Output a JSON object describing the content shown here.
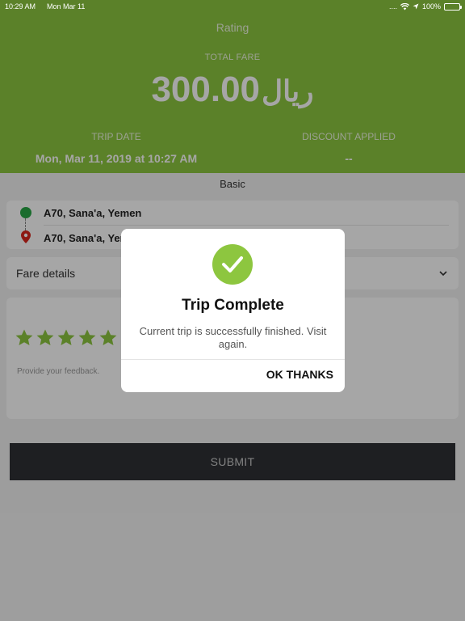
{
  "status_bar": {
    "time": "10:29 AM",
    "date": "Mon Mar 11",
    "battery": "100%"
  },
  "header": {
    "title": "Rating",
    "total_fare_label": "TOTAL FARE",
    "amount": "300.00",
    "currency": "ريال",
    "trip_date_label": "TRIP DATE",
    "trip_date_value": "Mon, Mar 11, 2019 at 10:27 AM",
    "discount_label": "DISCOUNT APPLIED",
    "discount_value": "--"
  },
  "vehicle_type": "Basic",
  "route": {
    "pickup": "A70,  Sana'a,  Yemen",
    "dropoff": "A70,  Sana'a,  Yemen"
  },
  "fare_details_label": "Fare details",
  "rating": {
    "stars": 5,
    "feedback_placeholder": "Provide your feedback."
  },
  "submit_label": "SUBMIT",
  "dialog": {
    "title": "Trip Complete",
    "message": "Current trip is successfully finished. Visit again.",
    "ok_label": "OK THANKS"
  },
  "colors": {
    "accent": "#8dc63f",
    "dark_button": "#2e3135",
    "pickup": "#28a745",
    "dropoff": "#d9261c"
  },
  "icons": [
    "wifi-icon",
    "location-arrow-icon",
    "battery-icon",
    "pickup-dot-icon",
    "dropoff-pin-icon",
    "chevron-down-icon",
    "star-icon",
    "checkmark-icon"
  ]
}
